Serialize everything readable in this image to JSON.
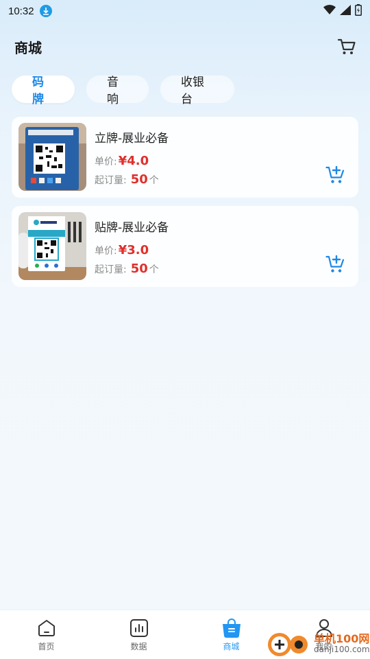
{
  "status_bar": {
    "time": "10:32"
  },
  "header": {
    "title": "商城"
  },
  "tabs": [
    {
      "label": "码牌",
      "active": true
    },
    {
      "label": "音响",
      "active": false
    },
    {
      "label": "收银台",
      "active": false
    }
  ],
  "products": [
    {
      "name": "立牌-展业必备",
      "price_label": "单价:",
      "price": "¥4.0",
      "moq_label": "起订量:",
      "moq": "50",
      "moq_unit": "个"
    },
    {
      "name": "贴牌-展业必备",
      "price_label": "单价:",
      "price": "¥3.0",
      "moq_label": "起订量:",
      "moq": "50",
      "moq_unit": "个"
    }
  ],
  "bottom_nav": [
    {
      "label": "首页",
      "icon": "home-icon",
      "active": false
    },
    {
      "label": "数据",
      "icon": "chart-icon",
      "active": false
    },
    {
      "label": "商城",
      "icon": "shop-bag-icon",
      "active": true
    },
    {
      "label": "我的",
      "icon": "user-icon",
      "active": false
    }
  ],
  "watermark": {
    "title": "单机100网",
    "url": "danji100.com"
  },
  "colors": {
    "accent": "#1e88e5",
    "price": "#e0302c",
    "active_nav": "#2196f3"
  }
}
